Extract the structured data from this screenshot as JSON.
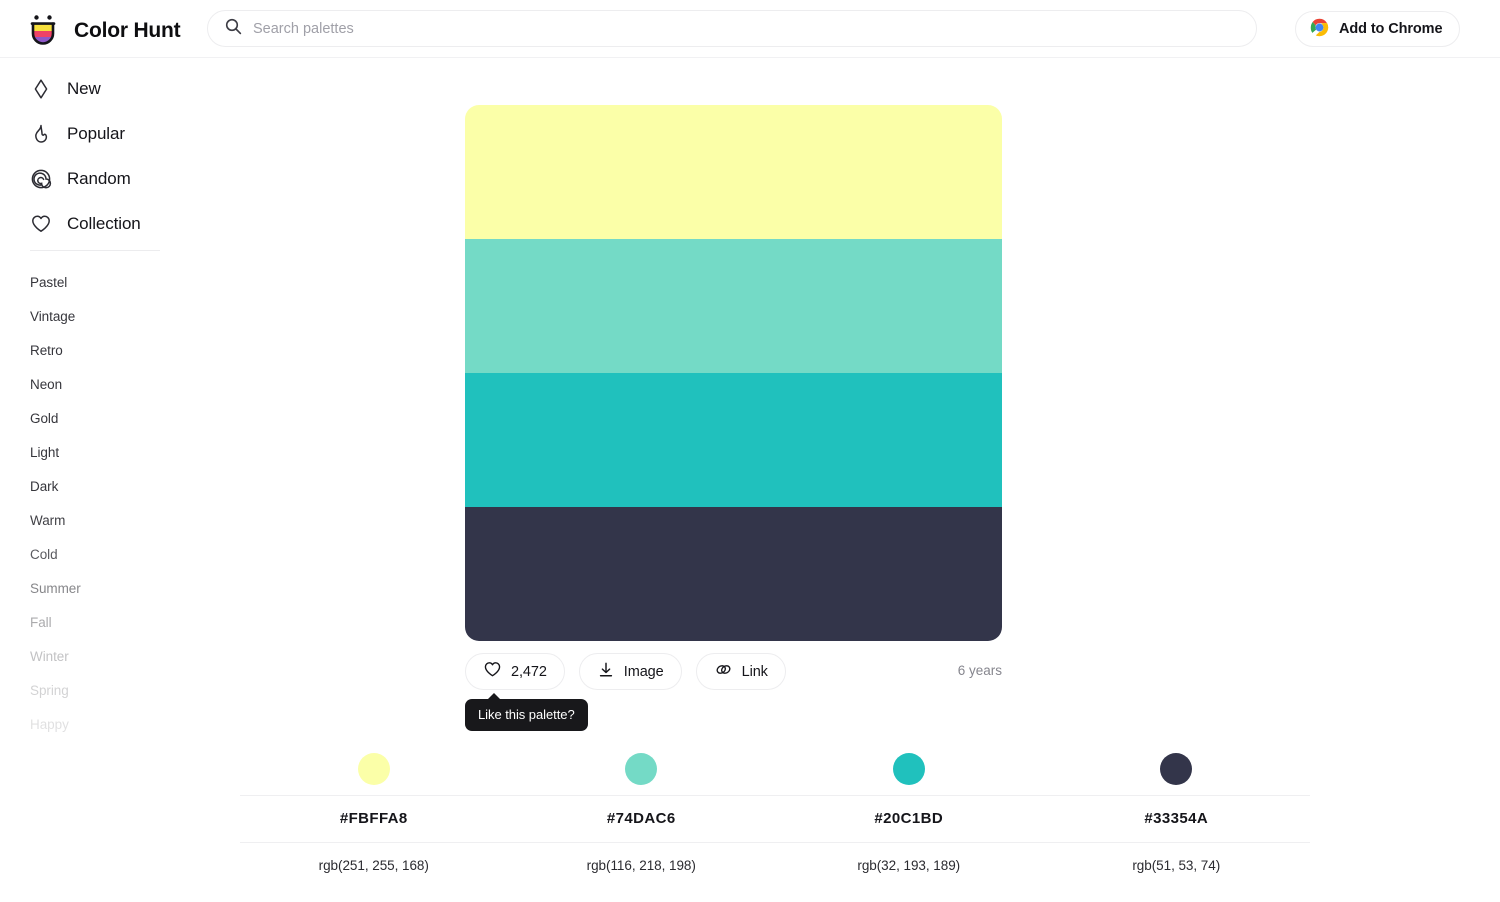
{
  "header": {
    "brand_name": "Color Hunt",
    "logo_icon": "colorhunt-smiley-logo",
    "search": {
      "icon": "search-icon",
      "placeholder": "Search palettes",
      "value": ""
    },
    "chrome_button": {
      "icon": "chrome-icon",
      "label": "Add to Chrome"
    }
  },
  "sidebar": {
    "nav": [
      {
        "label": "New",
        "icon": "sparkle-icon"
      },
      {
        "label": "Popular",
        "icon": "flame-icon"
      },
      {
        "label": "Random",
        "icon": "spiral-icon"
      },
      {
        "label": "Collection",
        "icon": "heart-icon"
      }
    ],
    "tags": [
      {
        "label": "Pastel",
        "opacity": 1.0
      },
      {
        "label": "Vintage",
        "opacity": 1.0
      },
      {
        "label": "Retro",
        "opacity": 1.0
      },
      {
        "label": "Neon",
        "opacity": 1.0
      },
      {
        "label": "Gold",
        "opacity": 1.0
      },
      {
        "label": "Light",
        "opacity": 1.0
      },
      {
        "label": "Dark",
        "opacity": 1.0
      },
      {
        "label": "Warm",
        "opacity": 0.95
      },
      {
        "label": "Cold",
        "opacity": 0.82
      },
      {
        "label": "Summer",
        "opacity": 0.6
      },
      {
        "label": "Fall",
        "opacity": 0.42
      },
      {
        "label": "Winter",
        "opacity": 0.3
      },
      {
        "label": "Spring",
        "opacity": 0.22
      },
      {
        "label": "Happy",
        "opacity": 0.15
      }
    ]
  },
  "palette": {
    "colors": [
      {
        "hex": "#FBFFA8",
        "rgb": "rgb(251, 255, 168)"
      },
      {
        "hex": "#74DAC6",
        "rgb": "rgb(116, 218, 198)"
      },
      {
        "hex": "#20C1BD",
        "rgb": "rgb(32, 193, 189)"
      },
      {
        "hex": "#33354A",
        "rgb": "rgb(51, 53, 74)"
      }
    ],
    "age": "6 years"
  },
  "actions": {
    "like": {
      "icon": "heart-icon",
      "count": "2,472"
    },
    "image": {
      "icon": "download-icon",
      "label": "Image"
    },
    "link": {
      "icon": "link-icon",
      "label": "Link"
    }
  },
  "tooltip": {
    "text": "Like this palette?"
  }
}
